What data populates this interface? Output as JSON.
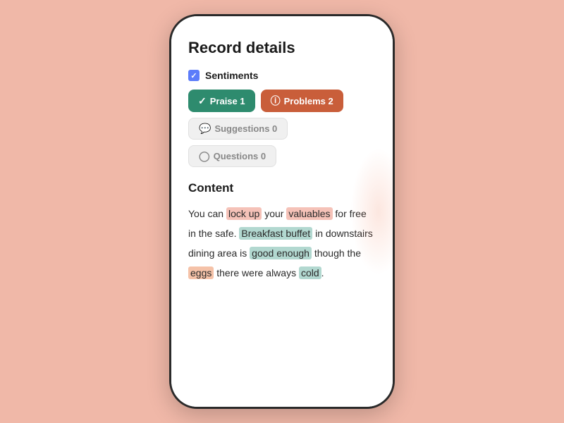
{
  "page": {
    "title": "Record details",
    "sentiments": {
      "label": "Sentiments",
      "badges": [
        {
          "id": "praise",
          "label": "Praise 1",
          "type": "praise",
          "icon": "✓"
        },
        {
          "id": "problems",
          "label": "Problems 2",
          "type": "problems",
          "icon": "!"
        },
        {
          "id": "suggestions",
          "label": "Suggestions 0",
          "type": "suggestions",
          "icon": "💬"
        },
        {
          "id": "questions",
          "label": "Questions 0",
          "type": "questions",
          "icon": "?"
        }
      ]
    },
    "content": {
      "title": "Content",
      "text_parts": [
        {
          "id": "t1",
          "text": "You can ",
          "highlight": false
        },
        {
          "id": "t2",
          "text": "lock up",
          "highlight": "red"
        },
        {
          "id": "t3",
          "text": " your ",
          "highlight": false
        },
        {
          "id": "t4",
          "text": "valuables",
          "highlight": "red"
        },
        {
          "id": "t5",
          "text": " for free in the safe. ",
          "highlight": false
        },
        {
          "id": "t6",
          "text": "Breakfast buffet",
          "highlight": "green"
        },
        {
          "id": "t7",
          "text": " in downstairs dining area is ",
          "highlight": false
        },
        {
          "id": "t8",
          "text": "good enough",
          "highlight": "green"
        },
        {
          "id": "t9",
          "text": " though the ",
          "highlight": false
        },
        {
          "id": "t10",
          "text": "eggs",
          "highlight": "orange"
        },
        {
          "id": "t11",
          "text": " there were always ",
          "highlight": false
        },
        {
          "id": "t12",
          "text": "cold",
          "highlight": "green"
        },
        {
          "id": "t13",
          "text": ".",
          "highlight": false
        }
      ]
    }
  }
}
